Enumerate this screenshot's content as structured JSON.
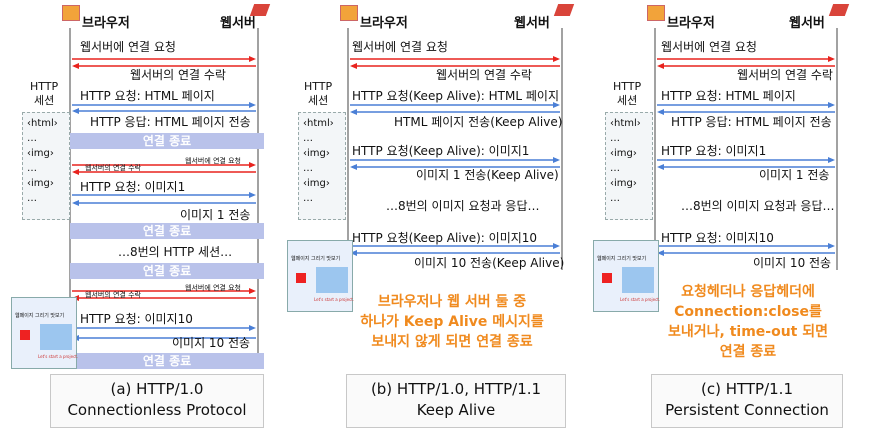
{
  "labels": {
    "browser": "브라우저",
    "server": "웹서버",
    "http_session": [
      "HTTP",
      "세션"
    ]
  },
  "session_items": [
    "‹html›",
    "…",
    "‹img›",
    "…",
    "‹img›",
    "…"
  ],
  "panelA": {
    "msgs": [
      "웹서버에 연결 요청",
      "웹서버의 연결 수락",
      "HTTP 요청: HTML 페이지",
      "HTTP 응답: HTML 페이지 전송",
      "웹서버에 연결 요청",
      "웹서버의 연결 수락",
      "HTTP 요청: 이미지1",
      "이미지 1 전송",
      "…8번의 HTTP 세션…",
      "웹서버에 연결 요청",
      "웹서버의 연결 수락",
      "HTTP 요청: 이미지10",
      "이미지 10 전송"
    ],
    "close": "연결 종료",
    "caption": [
      "(a) HTTP/1.0",
      "Connectionless Protocol"
    ]
  },
  "panelB": {
    "msgs": [
      "웹서버에 연결 요청",
      "웹서버의 연결 수락",
      "HTTP 요청(Keep Alive): HTML 페이지",
      "HTML 페이지 전송(Keep Alive)",
      "HTTP 요청(Keep Alive): 이미지1",
      "이미지 1 전송(Keep Alive)",
      "…8번의 이미지 요청과 응답…",
      "HTTP 요청(Keep Alive): 이미지10",
      "이미지 10 전송(Keep Alive)"
    ],
    "note": [
      "브라우저나 웹 서버 둘 중",
      "하나가 Keep Alive 메시지를",
      "보내지 않게 되면 연결 종료"
    ],
    "caption": [
      "(b) HTTP/1.0, HTTP/1.1",
      "Keep Alive"
    ]
  },
  "panelC": {
    "msgs": [
      "웹서버에 연결 요청",
      "웹서버의 연결 수락",
      "HTTP 요청: HTML 페이지",
      "HTTP 응답: HTML 페이지 전송",
      "HTTP 요청: 이미지1",
      "이미지 1 전송",
      "…8번의 이미지 요청과 응답…",
      "HTTP 요청: 이미지10",
      "이미지 10 전송"
    ],
    "note": [
      "요청헤더나 응답헤더에",
      "Connection:close를",
      "보내거나, time-out 되면",
      "연결 종료"
    ],
    "caption": [
      "(c) HTTP/1.1",
      "Persistent Connection"
    ]
  },
  "thumb": {
    "title": "웹페이지 그리기 맛보기",
    "caption": "Let's start a project."
  },
  "colors": {
    "request": "#e8231e",
    "response": "#4a7fd6",
    "close_bar": "#b9c2ea",
    "note": "#f08a1e"
  }
}
